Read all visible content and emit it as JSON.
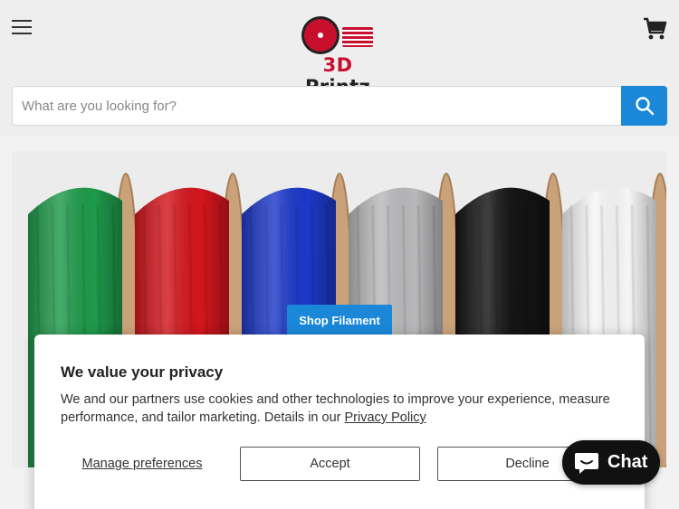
{
  "header": {
    "logo": {
      "brand_prefix": "3D",
      "brand_suffix": "Printz"
    },
    "menu_icon": "hamburger-menu-icon",
    "cart_icon": "shopping-cart-icon"
  },
  "search": {
    "placeholder": "What are you looking for?",
    "value": "",
    "button_icon": "search-icon"
  },
  "hero": {
    "button_label": "Shop Filament",
    "spool_colors": [
      "#1f9a4a",
      "#d3161d",
      "#1d39c9",
      "#b9b9bb",
      "#141414",
      "#f6f6f6"
    ]
  },
  "cookie_banner": {
    "title": "We value your privacy",
    "body": "We and our partners use cookies and other technologies to improve your experience, measure performance, and tailor marketing. Details in our",
    "policy_link": "Privacy Policy",
    "manage_label": "Manage preferences",
    "accept_label": "Accept",
    "decline_label": "Decline"
  },
  "chat": {
    "label": "Chat",
    "icon": "chat-bubble-icon"
  },
  "colors": {
    "accent_blue": "#1a87d9",
    "brand_red": "#c8102e"
  }
}
